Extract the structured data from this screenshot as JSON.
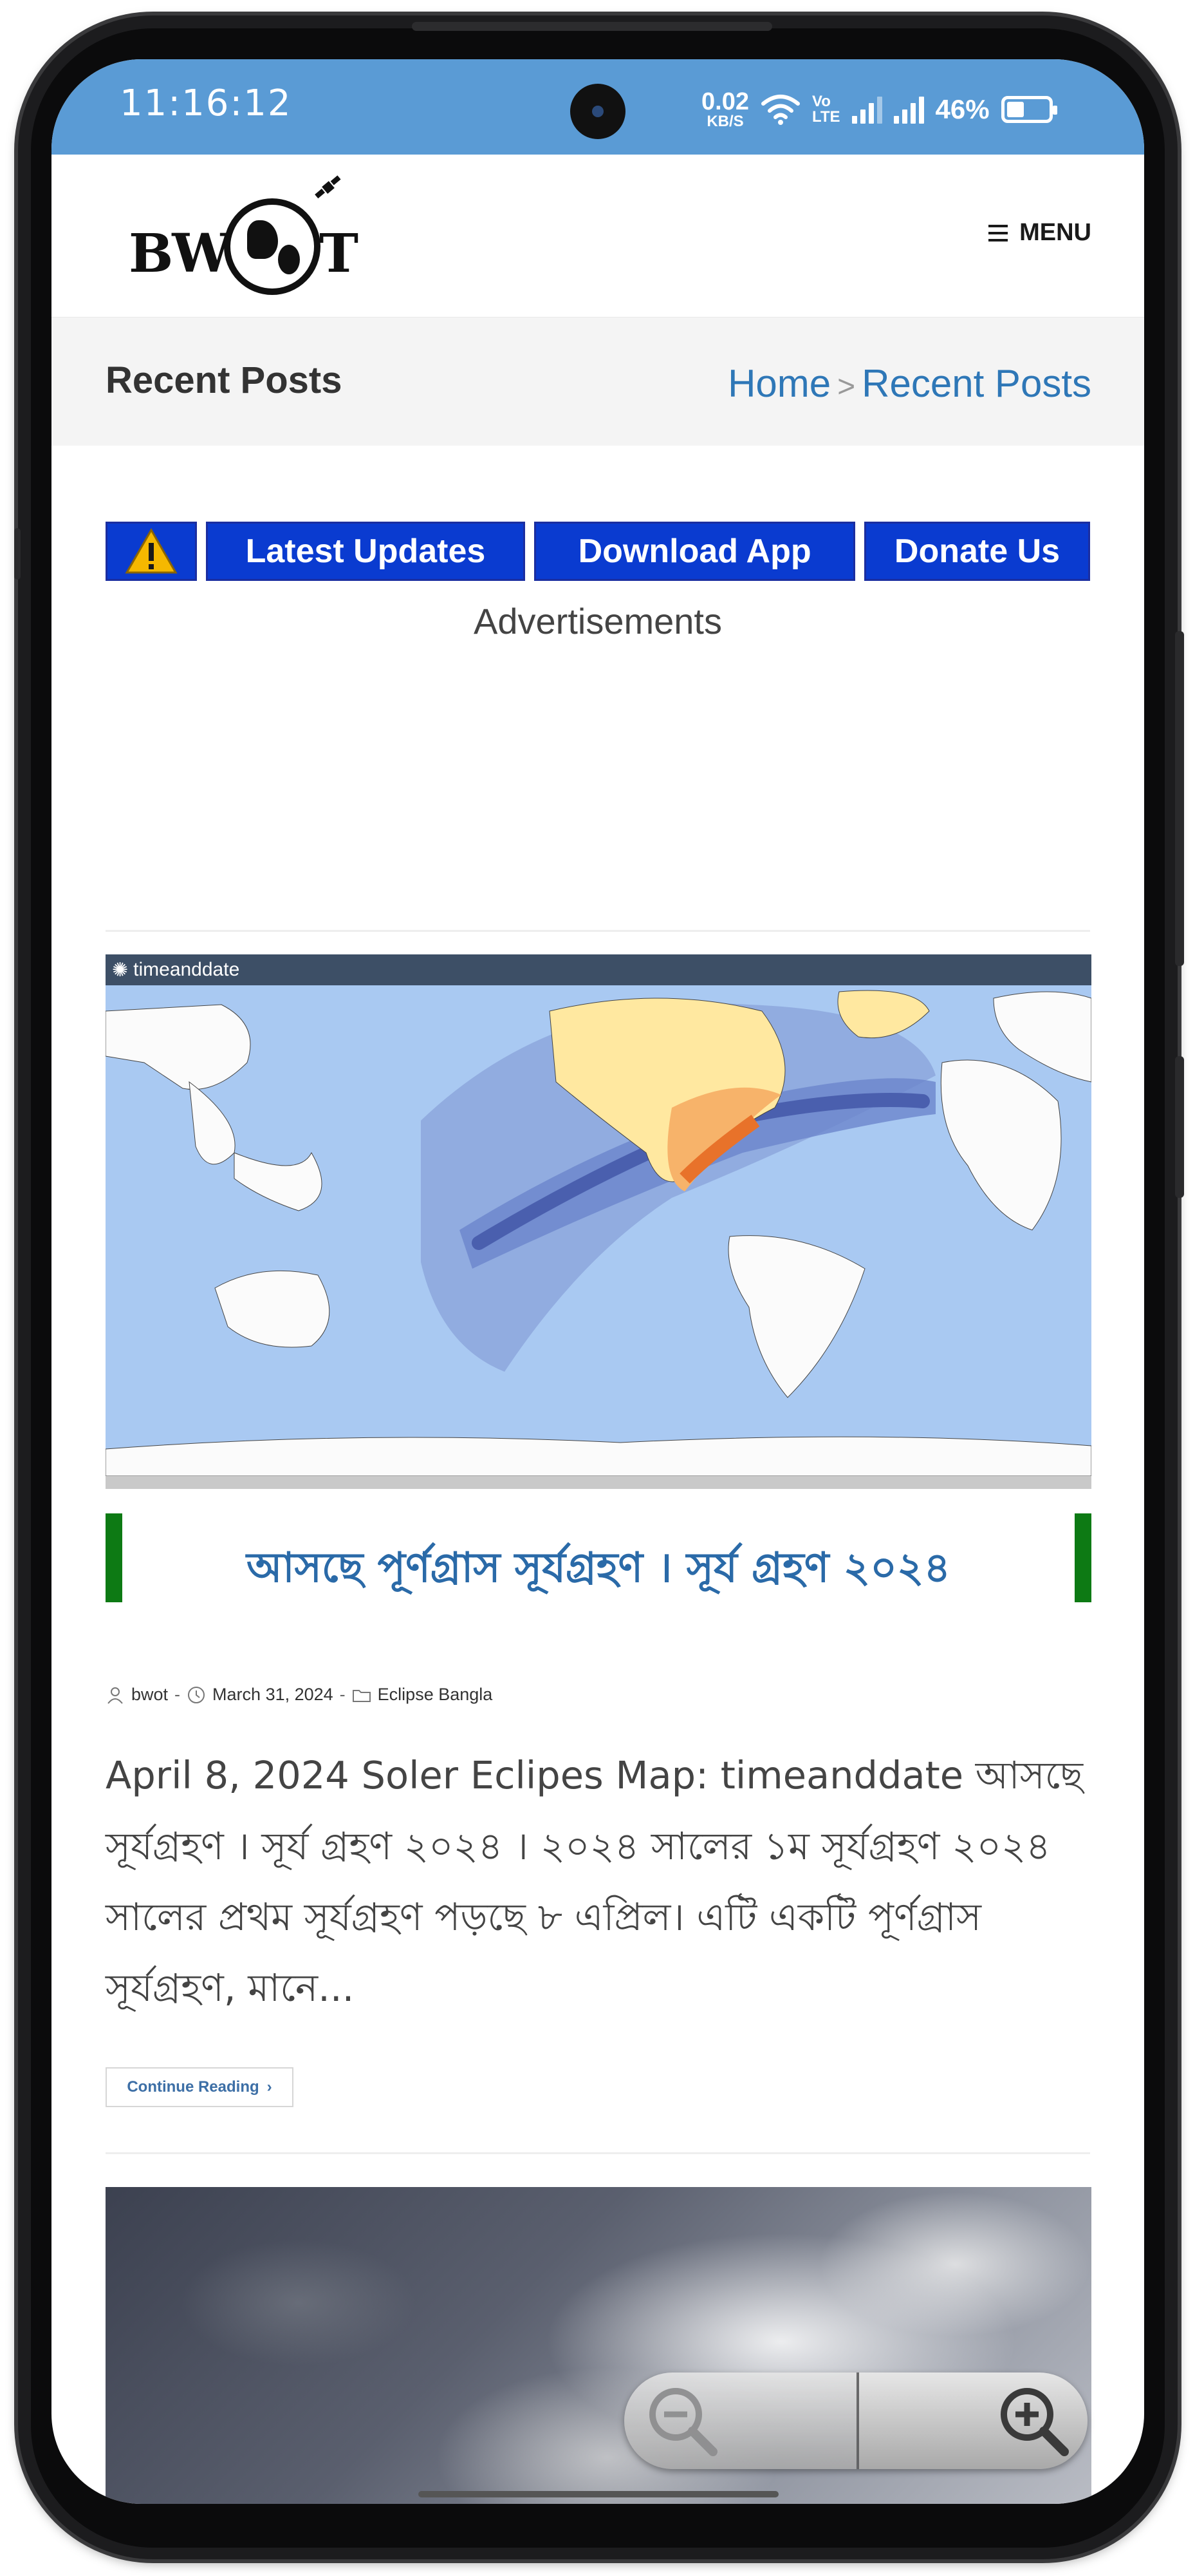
{
  "status_bar": {
    "time": "11:16:12",
    "net_speed_value": "0.02",
    "net_speed_unit": "KB/S",
    "volte_top": "Vo",
    "volte_bottom": "LTE",
    "battery_percent": "46%",
    "battery_level": 0.46,
    "bar_color": "#5a9bd5"
  },
  "header": {
    "logo_text": "BWOT",
    "menu_label": "MENU"
  },
  "page_title_bar": {
    "title": "Recent Posts",
    "breadcrumb": {
      "home": "Home",
      "separator": ">",
      "current": "Recent Posts"
    }
  },
  "action_buttons": {
    "warning_icon": "warning-icon",
    "latest_updates": "Latest Updates",
    "download_app": "Download App",
    "donate_us": "Donate Us",
    "button_color": "#0a3bd0"
  },
  "ads_label": "Advertisements",
  "post": {
    "image_source_label": "timeanddate",
    "title": "আসছে পূর্ণগ্রাস সূর্যগ্রহণ । সূর্য গ্রহণ ২০২৪",
    "meta": {
      "author": "bwot",
      "date": "March 31, 2024",
      "category": "Eclipse Bangla"
    },
    "excerpt": "April 8, 2024 Soler Eclipes Map: timeanddate আসছে সূর্যগ্রহণ । সূর্য গ্রহণ ২০২৪ । ২০২৪ সালের ১ম সূর্যগ্রহণ ২০২৪ সালের প্রথম সূর্যগ্রহণ পড়ছে ৮ এপ্রিল। এটি একটি পূর্ণগ্রাস সূর্যগ্রহণ, মানে...",
    "continue_label": "Continue Reading",
    "title_color": "#2a6aa8",
    "accent_bar_color": "#0d7a14"
  },
  "zoom_control": {
    "zoom_out_icon": "zoom-out-icon",
    "zoom_in_icon": "zoom-in-icon"
  }
}
